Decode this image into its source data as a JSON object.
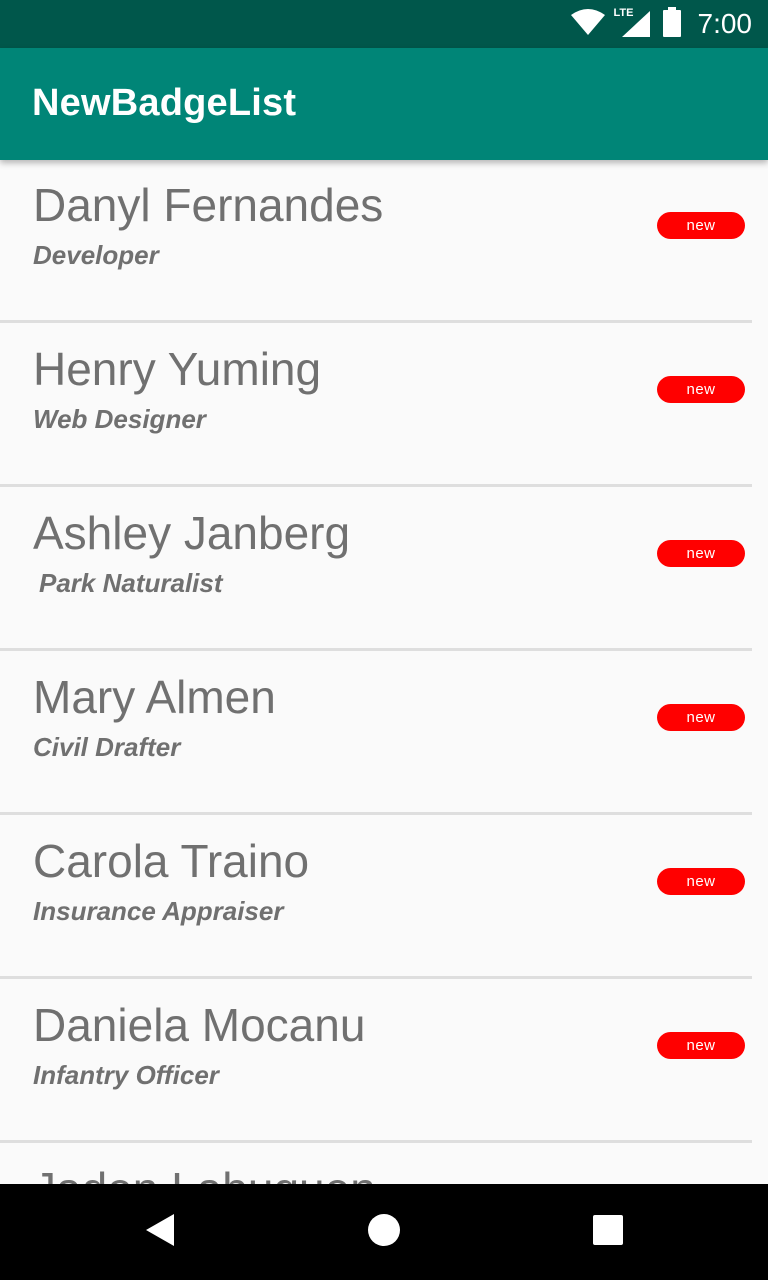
{
  "status_bar": {
    "time": "7:00",
    "network_label": "LTE",
    "icons": [
      "wifi-icon",
      "cell-signal-icon",
      "battery-icon"
    ]
  },
  "app_bar": {
    "title": "NewBadgeList",
    "background": "#008577"
  },
  "list": {
    "items": [
      {
        "name": "Danyl Fernandes",
        "role": "Developer",
        "badge": "new"
      },
      {
        "name": "Henry Yuming",
        "role": "Web Designer",
        "badge": "new"
      },
      {
        "name": "Ashley Janberg",
        "role": "Park Naturalist",
        "badge": "new"
      },
      {
        "name": "Mary Almen",
        "role": "Civil Drafter",
        "badge": "new"
      },
      {
        "name": "Carola Traino",
        "role": "Insurance Appraiser",
        "badge": "new"
      },
      {
        "name": "Daniela Mocanu",
        "role": "Infantry Officer",
        "badge": "new"
      },
      {
        "name": "Jaden Labuguen",
        "role": "",
        "badge": ""
      }
    ]
  },
  "colors": {
    "status_bar": "#00574b",
    "badge": "#ff0000",
    "text": "#707070"
  },
  "nav_bar": {
    "buttons": [
      "back-icon",
      "home-icon",
      "recents-icon"
    ]
  }
}
